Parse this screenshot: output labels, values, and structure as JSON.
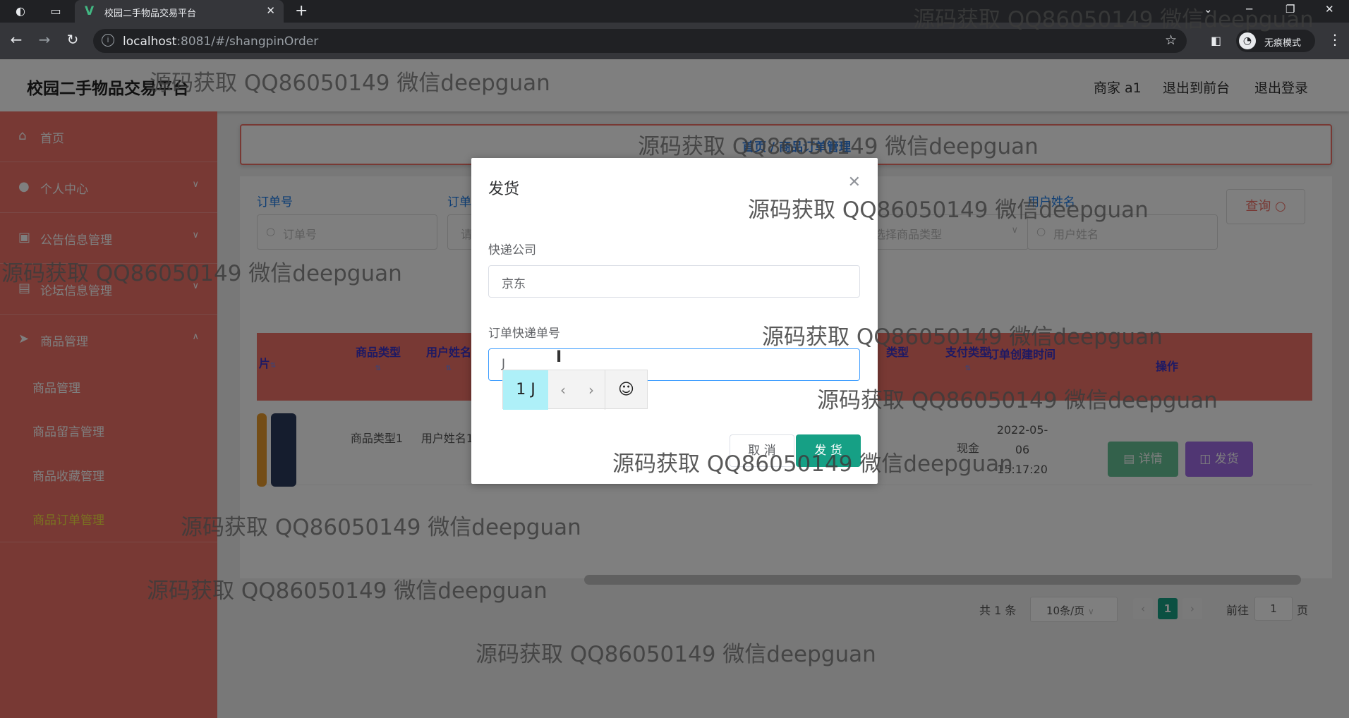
{
  "browser": {
    "tab_title": "校园二手物品交易平台",
    "url_host": "localhost",
    "url_path": ":8081/#/shangpinOrder",
    "incognito_label": "无痕模式",
    "icons": [
      "globe-icon",
      "window-icon",
      "vue-logo-icon",
      "close-icon",
      "plus-icon",
      "back-icon",
      "forward-icon",
      "reload-icon",
      "info-icon",
      "star-icon",
      "extension-icon",
      "incognito-icon",
      "menu-icon"
    ]
  },
  "header": {
    "site_title": "校园二手物品交易平台",
    "user": "商家 a1",
    "back_to_front": "退出到前台",
    "logout": "退出登录"
  },
  "sidebar": {
    "items": [
      {
        "label": "首页",
        "icon": "home-icon"
      },
      {
        "label": "个人中心",
        "icon": "user-icon"
      },
      {
        "label": "公告信息管理",
        "icon": "chart-icon"
      },
      {
        "label": "论坛信息管理",
        "icon": "clipboard-icon"
      },
      {
        "label": "商品管理",
        "icon": "send-icon"
      }
    ],
    "sub_items": [
      "商品管理",
      "商品留言管理",
      "商品收藏管理",
      "商品订单管理"
    ]
  },
  "breadcrumb": "首页 / 商品订单管理",
  "filters": {
    "order_no_label": "订单号",
    "order_no_placeholder": "订单号",
    "order_type_label": "订单",
    "order_type_placeholder": "请",
    "goods_type_placeholder": "选择商品类型",
    "user_name_label": "用户姓名",
    "user_name_placeholder": "用户姓名",
    "query_button": "查询"
  },
  "table": {
    "headers": {
      "image": "片",
      "goods_type": "商品类型",
      "user_name": "用户姓名",
      "order_type": "类型",
      "pay_type": "支付类型",
      "created": "订单创建时间",
      "actions": "操作"
    },
    "row": {
      "goods_type": "商品类型1",
      "user_name": "用户姓名1",
      "pay_type": "现金",
      "created": "2022-05-06 15:17:20",
      "detail_button": "详情",
      "ship_button": "发货"
    }
  },
  "pager": {
    "total": "共 1 条",
    "page_size": "10条/页",
    "current": "1",
    "goto_label": "前往",
    "goto_value": "1",
    "page_suffix": "页"
  },
  "dialog": {
    "title": "发货",
    "courier_label": "快递公司",
    "courier_value": "京东",
    "tracking_label": "订单快递单号",
    "tracking_value": "J",
    "ime_candidate": "1 J",
    "cancel": "取 消",
    "confirm": "发 货"
  },
  "watermark": "源码获取 QQ86050149 微信deepguan"
}
